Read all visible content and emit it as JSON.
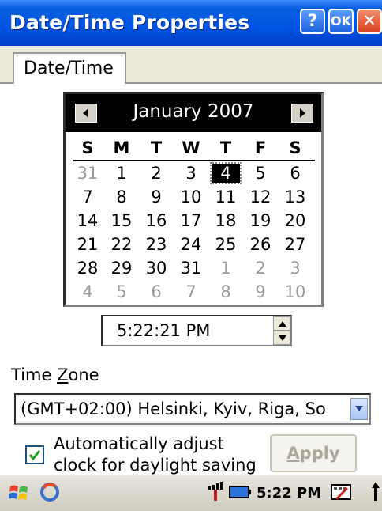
{
  "window": {
    "title": "Date/Time Properties",
    "help_label": "?",
    "ok_label": "OK",
    "close_label": "✕"
  },
  "tab": {
    "label": "Date/Time"
  },
  "calendar": {
    "month_label": "January 2007",
    "dow": [
      "S",
      "M",
      "T",
      "W",
      "T",
      "F",
      "S"
    ],
    "weeks": [
      [
        "31",
        "1",
        "2",
        "3",
        "4",
        "5",
        "6"
      ],
      [
        "7",
        "8",
        "9",
        "10",
        "11",
        "12",
        "13"
      ],
      [
        "14",
        "15",
        "16",
        "17",
        "18",
        "19",
        "20"
      ],
      [
        "21",
        "22",
        "23",
        "24",
        "25",
        "26",
        "27"
      ],
      [
        "28",
        "29",
        "30",
        "31",
        "1",
        "2",
        "3"
      ],
      [
        "4",
        "5",
        "6",
        "7",
        "8",
        "9",
        "10"
      ]
    ],
    "selected_day": "4"
  },
  "time": {
    "value": "5:22:21 PM"
  },
  "timezone": {
    "label_pre": "Time ",
    "label_access": "Z",
    "label_post": "one",
    "value": "(GMT+02:00) Helsinki, Kyiv, Riga, So"
  },
  "dst": {
    "line1": "Automatically adjust",
    "line2": "clock for daylight saving",
    "checked": true
  },
  "apply": {
    "label": "Apply",
    "access": "A"
  },
  "taskbar": {
    "clock": "5:22 PM"
  }
}
